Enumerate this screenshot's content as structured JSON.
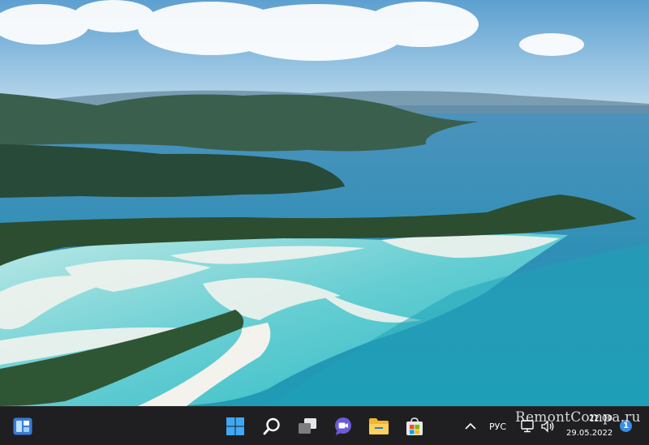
{
  "desktop": {
    "wallpaper": "aerial-beach-islands"
  },
  "taskbar": {
    "widgets": {
      "icon": "widgets-icon"
    },
    "pinned": [
      {
        "name": "start-button",
        "icon": "windows-logo-icon"
      },
      {
        "name": "search-button",
        "icon": "search-icon"
      },
      {
        "name": "task-view-button",
        "icon": "task-view-icon"
      },
      {
        "name": "chat-button",
        "icon": "chat-icon"
      },
      {
        "name": "file-explorer-button",
        "icon": "folder-icon"
      },
      {
        "name": "store-button",
        "icon": "store-icon"
      }
    ],
    "tray": {
      "overflow_icon": "chevron-up-icon",
      "language": "РУС",
      "network_icon": "network-icon",
      "volume_icon": "volume-icon",
      "time": "22:00",
      "date": "29.05.2022",
      "notification_count": "1"
    }
  },
  "watermark": {
    "text": "RemontCompa.ru"
  },
  "colors": {
    "taskbar_bg": "#1f1f21",
    "accent": "#3b8de0"
  }
}
